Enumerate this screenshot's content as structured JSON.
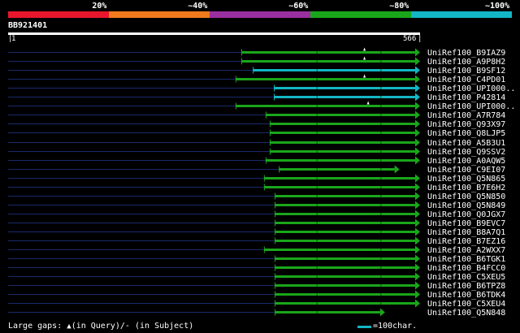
{
  "scale": {
    "labels": [
      "20%",
      "~40%",
      "~60%",
      "~80%",
      "~100%"
    ],
    "colors": [
      "#e8162c",
      "#f07a1c",
      "#9b2fa0",
      "#1aa61a",
      "#13b6c4"
    ]
  },
  "query": {
    "id": "BB921401",
    "start": "1",
    "end": "566"
  },
  "hits": [
    {
      "name": "UniRef100_B9IAZ9",
      "start": 0.567,
      "color": "#1aa61a",
      "q_gap": 0.865
    },
    {
      "name": "UniRef100_A9P8H2",
      "start": 0.567,
      "color": "#1aa61a",
      "q_gap": 0.865
    },
    {
      "name": "UniRef100_B9SF12",
      "start": 0.595,
      "color": "#13b6c4",
      "q_gap": null
    },
    {
      "name": "UniRef100_C4PD01",
      "start": 0.553,
      "color": "#1aa61a",
      "q_gap": 0.865
    },
    {
      "name": "UniRef100_UPI000..",
      "start": 0.646,
      "color": "#13b6c4",
      "q_gap": null
    },
    {
      "name": "UniRef100_P42814",
      "start": 0.646,
      "color": "#13b6c4",
      "q_gap": null
    },
    {
      "name": "UniRef100_UPI000..",
      "start": 0.553,
      "color": "#1aa61a",
      "q_gap": 0.874
    },
    {
      "name": "UniRef100_A7R784",
      "start": 0.626,
      "color": "#1aa61a",
      "q_gap": null
    },
    {
      "name": "UniRef100_Q93X97",
      "start": 0.636,
      "color": "#1aa61a",
      "q_gap": null
    },
    {
      "name": "UniRef100_Q8LJP5",
      "start": 0.636,
      "color": "#1aa61a",
      "q_gap": null
    },
    {
      "name": "UniRef100_A5B3U1",
      "start": 0.636,
      "color": "#1aa61a",
      "q_gap": null
    },
    {
      "name": "UniRef100_Q9SSV2",
      "start": 0.636,
      "color": "#1aa61a",
      "q_gap": null
    },
    {
      "name": "UniRef100_A0AQW5",
      "start": 0.626,
      "color": "#1aa61a",
      "q_gap": null
    },
    {
      "name": "UniRef100_C9EI07",
      "start": 0.658,
      "color": "#1aa61a",
      "q_gap": null,
      "end": 0.95
    },
    {
      "name": "UniRef100_Q5N865",
      "start": 0.622,
      "color": "#1aa61a",
      "q_gap": null
    },
    {
      "name": "UniRef100_B7E6H2",
      "start": 0.622,
      "color": "#1aa61a",
      "q_gap": null
    },
    {
      "name": "UniRef100_Q5N850",
      "start": 0.648,
      "color": "#1aa61a",
      "q_gap": null
    },
    {
      "name": "UniRef100_Q5N849",
      "start": 0.648,
      "color": "#1aa61a",
      "q_gap": null
    },
    {
      "name": "UniRef100_Q0JGX7",
      "start": 0.648,
      "color": "#1aa61a",
      "q_gap": null
    },
    {
      "name": "UniRef100_B9EVC7",
      "start": 0.648,
      "color": "#1aa61a",
      "q_gap": null
    },
    {
      "name": "UniRef100_B8A7Q1",
      "start": 0.648,
      "color": "#1aa61a",
      "q_gap": null
    },
    {
      "name": "UniRef100_B7EZ16",
      "start": 0.648,
      "color": "#1aa61a",
      "q_gap": null
    },
    {
      "name": "UniRef100_A2WXX7",
      "start": 0.622,
      "color": "#1aa61a",
      "q_gap": null
    },
    {
      "name": "UniRef100_B6TGK1",
      "start": 0.648,
      "color": "#1aa61a",
      "q_gap": null
    },
    {
      "name": "UniRef100_B4FCC0",
      "start": 0.648,
      "color": "#1aa61a",
      "q_gap": null
    },
    {
      "name": "UniRef100_C5XEU5",
      "start": 0.648,
      "color": "#1aa61a",
      "q_gap": null
    },
    {
      "name": "UniRef100_B6TPZ8",
      "start": 0.648,
      "color": "#1aa61a",
      "q_gap": null
    },
    {
      "name": "UniRef100_B6TDK4",
      "start": 0.648,
      "color": "#1aa61a",
      "q_gap": null
    },
    {
      "name": "UniRef100_C5XEU4",
      "start": 0.648,
      "color": "#1aa61a",
      "q_gap": null
    },
    {
      "name": "UniRef100_Q5N848",
      "start": 0.648,
      "color": "#1aa61a",
      "q_gap": null,
      "end": 0.915
    }
  ],
  "footer": {
    "gaps_prefix": "Large gaps:",
    "gaps_query": "(in Query)/",
    "gaps_subject": "(in Subject)",
    "legend_label": "=100char.",
    "legend_color": "#13b6c4"
  }
}
